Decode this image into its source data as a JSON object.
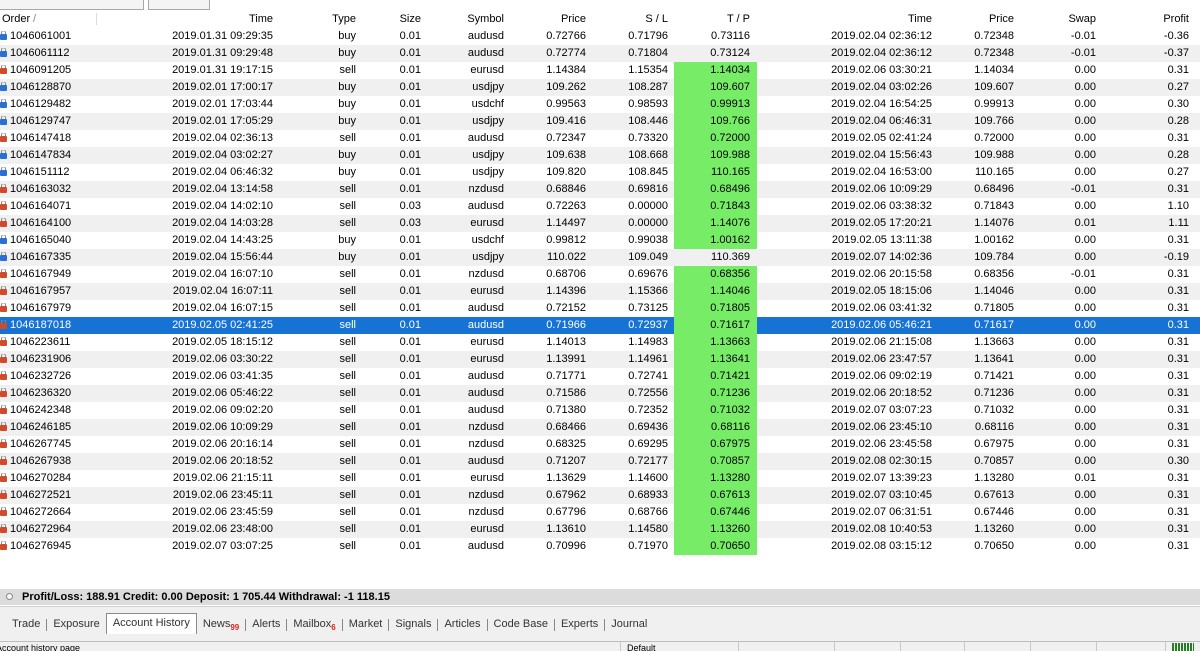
{
  "header": {
    "order": "Order",
    "time_open": "Time",
    "type": "Type",
    "size": "Size",
    "symbol": "Symbol",
    "price_open": "Price",
    "sl": "S / L",
    "tp": "T / P",
    "time_close": "Time",
    "price_close": "Price",
    "swap": "Swap",
    "profit": "Profit"
  },
  "rows": [
    {
      "order": "1046061001",
      "time": "2019.01.31 09:29:35",
      "type": "buy",
      "size": "0.01",
      "symbol": "audusd",
      "price": "0.72766",
      "sl": "0.71796",
      "tp": "0.73116",
      "close_time": "2019.02.04 02:36:12",
      "close_price": "0.72348",
      "swap": "-0.01",
      "profit": "-0.36",
      "tp_hit": false
    },
    {
      "order": "1046061112",
      "time": "2019.01.31 09:29:48",
      "type": "buy",
      "size": "0.01",
      "symbol": "audusd",
      "price": "0.72774",
      "sl": "0.71804",
      "tp": "0.73124",
      "close_time": "2019.02.04 02:36:12",
      "close_price": "0.72348",
      "swap": "-0.01",
      "profit": "-0.37",
      "tp_hit": false
    },
    {
      "order": "1046091205",
      "time": "2019.01.31 19:17:15",
      "type": "sell",
      "size": "0.01",
      "symbol": "eurusd",
      "price": "1.14384",
      "sl": "1.15354",
      "tp": "1.14034",
      "close_time": "2019.02.06 03:30:21",
      "close_price": "1.14034",
      "swap": "0.00",
      "profit": "0.31",
      "tp_hit": true
    },
    {
      "order": "1046128870",
      "time": "2019.02.01 17:00:17",
      "type": "buy",
      "size": "0.01",
      "symbol": "usdjpy",
      "price": "109.262",
      "sl": "108.287",
      "tp": "109.607",
      "close_time": "2019.02.04 03:02:26",
      "close_price": "109.607",
      "swap": "0.00",
      "profit": "0.27",
      "tp_hit": true
    },
    {
      "order": "1046129482",
      "time": "2019.02.01 17:03:44",
      "type": "buy",
      "size": "0.01",
      "symbol": "usdchf",
      "price": "0.99563",
      "sl": "0.98593",
      "tp": "0.99913",
      "close_time": "2019.02.04 16:54:25",
      "close_price": "0.99913",
      "swap": "0.00",
      "profit": "0.30",
      "tp_hit": true
    },
    {
      "order": "1046129747",
      "time": "2019.02.01 17:05:29",
      "type": "buy",
      "size": "0.01",
      "symbol": "usdjpy",
      "price": "109.416",
      "sl": "108.446",
      "tp": "109.766",
      "close_time": "2019.02.04 06:46:31",
      "close_price": "109.766",
      "swap": "0.00",
      "profit": "0.28",
      "tp_hit": true
    },
    {
      "order": "1046147418",
      "time": "2019.02.04 02:36:13",
      "type": "sell",
      "size": "0.01",
      "symbol": "audusd",
      "price": "0.72347",
      "sl": "0.73320",
      "tp": "0.72000",
      "close_time": "2019.02.05 02:41:24",
      "close_price": "0.72000",
      "swap": "0.00",
      "profit": "0.31",
      "tp_hit": true
    },
    {
      "order": "1046147834",
      "time": "2019.02.04 03:02:27",
      "type": "buy",
      "size": "0.01",
      "symbol": "usdjpy",
      "price": "109.638",
      "sl": "108.668",
      "tp": "109.988",
      "close_time": "2019.02.04 15:56:43",
      "close_price": "109.988",
      "swap": "0.00",
      "profit": "0.28",
      "tp_hit": true
    },
    {
      "order": "1046151112",
      "time": "2019.02.04 06:46:32",
      "type": "buy",
      "size": "0.01",
      "symbol": "usdjpy",
      "price": "109.820",
      "sl": "108.845",
      "tp": "110.165",
      "close_time": "2019.02.04 16:53:00",
      "close_price": "110.165",
      "swap": "0.00",
      "profit": "0.27",
      "tp_hit": true
    },
    {
      "order": "1046163032",
      "time": "2019.02.04 13:14:58",
      "type": "sell",
      "size": "0.01",
      "symbol": "nzdusd",
      "price": "0.68846",
      "sl": "0.69816",
      "tp": "0.68496",
      "close_time": "2019.02.06 10:09:29",
      "close_price": "0.68496",
      "swap": "-0.01",
      "profit": "0.31",
      "tp_hit": true
    },
    {
      "order": "1046164071",
      "time": "2019.02.04 14:02:10",
      "type": "sell",
      "size": "0.03",
      "symbol": "audusd",
      "price": "0.72263",
      "sl": "0.00000",
      "tp": "0.71843",
      "close_time": "2019.02.06 03:38:32",
      "close_price": "0.71843",
      "swap": "0.00",
      "profit": "1.10",
      "tp_hit": true
    },
    {
      "order": "1046164100",
      "time": "2019.02.04 14:03:28",
      "type": "sell",
      "size": "0.03",
      "symbol": "eurusd",
      "price": "1.14497",
      "sl": "0.00000",
      "tp": "1.14076",
      "close_time": "2019.02.05 17:20:21",
      "close_price": "1.14076",
      "swap": "0.01",
      "profit": "1.11",
      "tp_hit": true
    },
    {
      "order": "1046165040",
      "time": "2019.02.04 14:43:25",
      "type": "buy",
      "size": "0.01",
      "symbol": "usdchf",
      "price": "0.99812",
      "sl": "0.99038",
      "tp": "1.00162",
      "close_time": "2019.02.05 13:11:38",
      "close_price": "1.00162",
      "swap": "0.00",
      "profit": "0.31",
      "tp_hit": true
    },
    {
      "order": "1046167335",
      "time": "2019.02.04 15:56:44",
      "type": "buy",
      "size": "0.01",
      "symbol": "usdjpy",
      "price": "110.022",
      "sl": "109.049",
      "tp": "110.369",
      "close_time": "2019.02.07 14:02:36",
      "close_price": "109.784",
      "swap": "0.00",
      "profit": "-0.19",
      "tp_hit": false
    },
    {
      "order": "1046167949",
      "time": "2019.02.04 16:07:10",
      "type": "sell",
      "size": "0.01",
      "symbol": "nzdusd",
      "price": "0.68706",
      "sl": "0.69676",
      "tp": "0.68356",
      "close_time": "2019.02.06 20:15:58",
      "close_price": "0.68356",
      "swap": "-0.01",
      "profit": "0.31",
      "tp_hit": true
    },
    {
      "order": "1046167957",
      "time": "2019.02.04 16:07:11",
      "type": "sell",
      "size": "0.01",
      "symbol": "eurusd",
      "price": "1.14396",
      "sl": "1.15366",
      "tp": "1.14046",
      "close_time": "2019.02.05 18:15:06",
      "close_price": "1.14046",
      "swap": "0.00",
      "profit": "0.31",
      "tp_hit": true
    },
    {
      "order": "1046167979",
      "time": "2019.02.04 16:07:15",
      "type": "sell",
      "size": "0.01",
      "symbol": "audusd",
      "price": "0.72152",
      "sl": "0.73125",
      "tp": "0.71805",
      "close_time": "2019.02.06 03:41:32",
      "close_price": "0.71805",
      "swap": "0.00",
      "profit": "0.31",
      "tp_hit": true
    },
    {
      "order": "1046187018",
      "time": "2019.02.05 02:41:25",
      "type": "sell",
      "size": "0.01",
      "symbol": "audusd",
      "price": "0.71966",
      "sl": "0.72937",
      "tp": "0.71617",
      "close_time": "2019.02.06 05:46:21",
      "close_price": "0.71617",
      "swap": "0.00",
      "profit": "0.31",
      "tp_hit": true,
      "selected": true
    },
    {
      "order": "1046223611",
      "time": "2019.02.05 18:15:12",
      "type": "sell",
      "size": "0.01",
      "symbol": "eurusd",
      "price": "1.14013",
      "sl": "1.14983",
      "tp": "1.13663",
      "close_time": "2019.02.06 21:15:08",
      "close_price": "1.13663",
      "swap": "0.00",
      "profit": "0.31",
      "tp_hit": true
    },
    {
      "order": "1046231906",
      "time": "2019.02.06 03:30:22",
      "type": "sell",
      "size": "0.01",
      "symbol": "eurusd",
      "price": "1.13991",
      "sl": "1.14961",
      "tp": "1.13641",
      "close_time": "2019.02.06 23:47:57",
      "close_price": "1.13641",
      "swap": "0.00",
      "profit": "0.31",
      "tp_hit": true
    },
    {
      "order": "1046232726",
      "time": "2019.02.06 03:41:35",
      "type": "sell",
      "size": "0.01",
      "symbol": "audusd",
      "price": "0.71771",
      "sl": "0.72741",
      "tp": "0.71421",
      "close_time": "2019.02.06 09:02:19",
      "close_price": "0.71421",
      "swap": "0.00",
      "profit": "0.31",
      "tp_hit": true
    },
    {
      "order": "1046236320",
      "time": "2019.02.06 05:46:22",
      "type": "sell",
      "size": "0.01",
      "symbol": "audusd",
      "price": "0.71586",
      "sl": "0.72556",
      "tp": "0.71236",
      "close_time": "2019.02.06 20:18:52",
      "close_price": "0.71236",
      "swap": "0.00",
      "profit": "0.31",
      "tp_hit": true
    },
    {
      "order": "1046242348",
      "time": "2019.02.06 09:02:20",
      "type": "sell",
      "size": "0.01",
      "symbol": "audusd",
      "price": "0.71380",
      "sl": "0.72352",
      "tp": "0.71032",
      "close_time": "2019.02.07 03:07:23",
      "close_price": "0.71032",
      "swap": "0.00",
      "profit": "0.31",
      "tp_hit": true
    },
    {
      "order": "1046246185",
      "time": "2019.02.06 10:09:29",
      "type": "sell",
      "size": "0.01",
      "symbol": "nzdusd",
      "price": "0.68466",
      "sl": "0.69436",
      "tp": "0.68116",
      "close_time": "2019.02.06 23:45:10",
      "close_price": "0.68116",
      "swap": "0.00",
      "profit": "0.31",
      "tp_hit": true
    },
    {
      "order": "1046267745",
      "time": "2019.02.06 20:16:14",
      "type": "sell",
      "size": "0.01",
      "symbol": "nzdusd",
      "price": "0.68325",
      "sl": "0.69295",
      "tp": "0.67975",
      "close_time": "2019.02.06 23:45:58",
      "close_price": "0.67975",
      "swap": "0.00",
      "profit": "0.31",
      "tp_hit": true
    },
    {
      "order": "1046267938",
      "time": "2019.02.06 20:18:52",
      "type": "sell",
      "size": "0.01",
      "symbol": "audusd",
      "price": "0.71207",
      "sl": "0.72177",
      "tp": "0.70857",
      "close_time": "2019.02.08 02:30:15",
      "close_price": "0.70857",
      "swap": "0.00",
      "profit": "0.30",
      "tp_hit": true
    },
    {
      "order": "1046270284",
      "time": "2019.02.06 21:15:11",
      "type": "sell",
      "size": "0.01",
      "symbol": "eurusd",
      "price": "1.13629",
      "sl": "1.14600",
      "tp": "1.13280",
      "close_time": "2019.02.07 13:39:23",
      "close_price": "1.13280",
      "swap": "0.01",
      "profit": "0.31",
      "tp_hit": true
    },
    {
      "order": "1046272521",
      "time": "2019.02.06 23:45:11",
      "type": "sell",
      "size": "0.01",
      "symbol": "nzdusd",
      "price": "0.67962",
      "sl": "0.68933",
      "tp": "0.67613",
      "close_time": "2019.02.07 03:10:45",
      "close_price": "0.67613",
      "swap": "0.00",
      "profit": "0.31",
      "tp_hit": true
    },
    {
      "order": "1046272664",
      "time": "2019.02.06 23:45:59",
      "type": "sell",
      "size": "0.01",
      "symbol": "nzdusd",
      "price": "0.67796",
      "sl": "0.68766",
      "tp": "0.67446",
      "close_time": "2019.02.07 06:31:51",
      "close_price": "0.67446",
      "swap": "0.00",
      "profit": "0.31",
      "tp_hit": true
    },
    {
      "order": "1046272964",
      "time": "2019.02.06 23:48:00",
      "type": "sell",
      "size": "0.01",
      "symbol": "eurusd",
      "price": "1.13610",
      "sl": "1.14580",
      "tp": "1.13260",
      "close_time": "2019.02.08 10:40:53",
      "close_price": "1.13260",
      "swap": "0.00",
      "profit": "0.31",
      "tp_hit": true
    },
    {
      "order": "1046276945",
      "time": "2019.02.07 03:07:25",
      "type": "sell",
      "size": "0.01",
      "symbol": "audusd",
      "price": "0.70996",
      "sl": "0.71970",
      "tp": "0.70650",
      "close_time": "2019.02.08 03:15:12",
      "close_price": "0.70650",
      "swap": "0.00",
      "profit": "0.31",
      "tp_hit": true
    }
  ],
  "summary": "Profit/Loss: 188.91  Credit: 0.00  Deposit: 1 705.44  Withdrawal: -1 118.15",
  "tabs": [
    {
      "label": "Trade",
      "badge": ""
    },
    {
      "label": "Exposure",
      "badge": ""
    },
    {
      "label": "Account History",
      "badge": "",
      "active": true
    },
    {
      "label": "News",
      "badge": "99"
    },
    {
      "label": "Alerts",
      "badge": ""
    },
    {
      "label": "Mailbox",
      "badge": "6"
    },
    {
      "label": "Market",
      "badge": ""
    },
    {
      "label": "Signals",
      "badge": ""
    },
    {
      "label": "Articles",
      "badge": ""
    },
    {
      "label": "Code Base",
      "badge": ""
    },
    {
      "label": "Experts",
      "badge": ""
    },
    {
      "label": "Journal",
      "badge": ""
    }
  ],
  "statusbar": {
    "left": "Account history page",
    "mid": "Default"
  },
  "colors": {
    "selected_row": "#1673d3",
    "tp_hit": "#77ec67",
    "alt_row": "#f0f0f0",
    "summary_bg": "#dcdcdc"
  },
  "icons": {
    "buy": "buy-order-icon",
    "sell": "sell-order-icon"
  }
}
